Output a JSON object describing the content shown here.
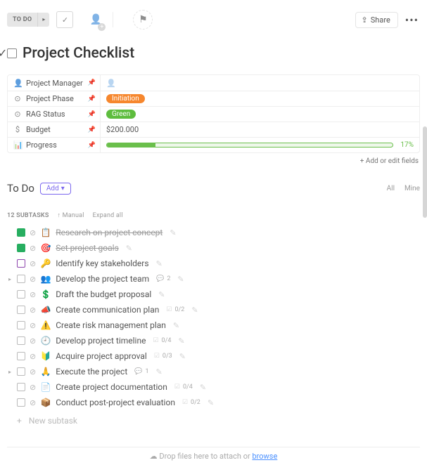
{
  "toolbar": {
    "status": "TO DO",
    "share": "Share"
  },
  "title": "Project Checklist",
  "properties": [
    {
      "icon": "user",
      "label": "Project Manager",
      "value_type": "user",
      "value": ""
    },
    {
      "icon": "dropdown",
      "label": "Project Phase",
      "value_type": "tag",
      "value": "Initiation",
      "color": "orange"
    },
    {
      "icon": "dropdown",
      "label": "RAG Status",
      "value_type": "tag",
      "value": "Green",
      "color": "green"
    },
    {
      "icon": "dollar",
      "label": "Budget",
      "value_type": "text",
      "value": "$200.000"
    },
    {
      "icon": "progress",
      "label": "Progress",
      "value_type": "progress",
      "percent": 17
    }
  ],
  "add_edit_fields": "+ Add or edit fields",
  "section": {
    "title": "To Do",
    "add_label": "Add",
    "filters": {
      "all": "All",
      "mine": "Mine"
    }
  },
  "subtasks_header": {
    "count_label": "12 SUBTASKS",
    "sort": "Manual",
    "expand": "Expand all"
  },
  "tasks": [
    {
      "expand": false,
      "status": "done",
      "emoji": "📋",
      "name": "Research on project concept",
      "meta": null
    },
    {
      "expand": false,
      "status": "done",
      "emoji": "🎯",
      "name": "Set project goals",
      "meta": null
    },
    {
      "expand": false,
      "status": "progress",
      "emoji": "🔑",
      "name": "Identify key stakeholders",
      "meta": null
    },
    {
      "expand": true,
      "status": "open",
      "emoji": "👥",
      "name": "Develop the project team",
      "meta": {
        "type": "comments",
        "text": "2"
      }
    },
    {
      "expand": false,
      "status": "open",
      "emoji": "💲",
      "name": "Draft the budget proposal",
      "meta": null
    },
    {
      "expand": false,
      "status": "open",
      "emoji": "📣",
      "name": "Create communication plan",
      "meta": {
        "type": "checklist",
        "text": "0/2"
      }
    },
    {
      "expand": false,
      "status": "open",
      "emoji": "⚠️",
      "name": "Create risk management plan",
      "meta": null
    },
    {
      "expand": false,
      "status": "open",
      "emoji": "🕘",
      "name": "Develop project timeline",
      "meta": {
        "type": "checklist",
        "text": "0/4"
      }
    },
    {
      "expand": false,
      "status": "open",
      "emoji": "🔰",
      "name": "Acquire project approval",
      "meta": {
        "type": "checklist",
        "text": "0/3"
      }
    },
    {
      "expand": true,
      "status": "open",
      "emoji": "🙏",
      "name": "Execute the project",
      "meta": {
        "type": "comments",
        "text": "1"
      }
    },
    {
      "expand": false,
      "status": "open",
      "emoji": "📄",
      "name": "Create project documentation",
      "meta": {
        "type": "checklist",
        "text": "0/4"
      }
    },
    {
      "expand": false,
      "status": "open",
      "emoji": "📦",
      "name": "Conduct post-project evaluation",
      "meta": {
        "type": "checklist",
        "text": "0/2"
      }
    }
  ],
  "new_subtask": "New subtask",
  "drop_zone": {
    "text": "Drop files here to attach or ",
    "link": "browse"
  }
}
